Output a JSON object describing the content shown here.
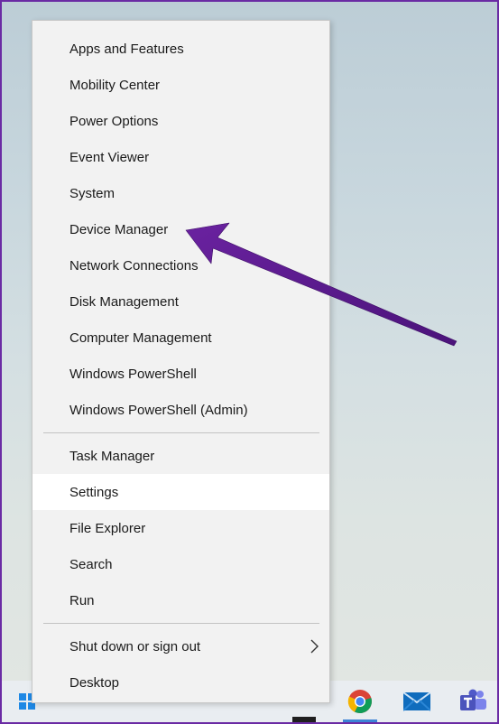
{
  "menu": {
    "items": [
      {
        "label": "Apps and Features"
      },
      {
        "label": "Mobility Center"
      },
      {
        "label": "Power Options"
      },
      {
        "label": "Event Viewer"
      },
      {
        "label": "System"
      },
      {
        "label": "Device Manager"
      },
      {
        "label": "Network Connections"
      },
      {
        "label": "Disk Management"
      },
      {
        "label": "Computer Management"
      },
      {
        "label": "Windows PowerShell"
      },
      {
        "label": "Windows PowerShell (Admin)"
      },
      {
        "label": "Task Manager"
      },
      {
        "label": "Settings",
        "highlighted": true
      },
      {
        "label": "File Explorer"
      },
      {
        "label": "Search"
      },
      {
        "label": "Run"
      },
      {
        "label": "Shut down or sign out",
        "has_submenu": true
      },
      {
        "label": "Desktop"
      }
    ]
  },
  "annotation": {
    "points_to": "Device Manager",
    "color": "#5b1a8b"
  },
  "taskbar": {
    "icons": [
      "windows-start-icon",
      "chrome-icon",
      "mail-icon",
      "teams-icon"
    ]
  },
  "colors": {
    "frame": "#6a2ba4",
    "menu_bg": "#f2f2f2",
    "highlight": "#ffffff"
  }
}
